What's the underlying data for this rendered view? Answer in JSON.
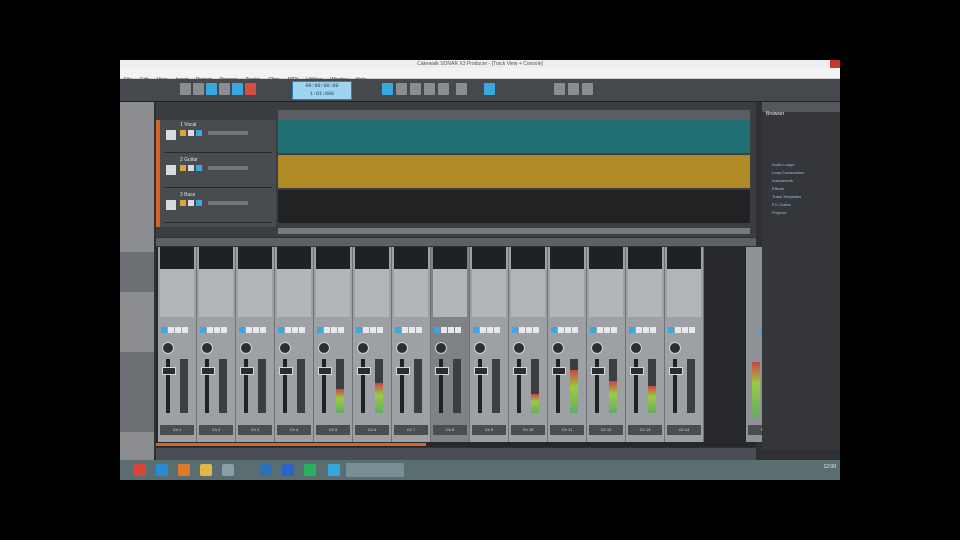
{
  "app": {
    "title": "Cakewalk SONAR X3 Producer - [Track View + Console]",
    "accent": "#3fa6d9",
    "track_color": "#d9622b"
  },
  "menu": [
    "File",
    "Edit",
    "View",
    "Insert",
    "Project",
    "Process",
    "Tracks",
    "Clips",
    "MIDI",
    "Utilities",
    "Window",
    "Help"
  ],
  "transport": {
    "time_primary": "00:00:00:00",
    "time_secondary": "1:01:000"
  },
  "tracks": [
    {
      "name": "1 Vocal",
      "clip_color": "#1f6f73"
    },
    {
      "name": "2 Guitar",
      "clip_color": "#b08a25"
    },
    {
      "name": "3 Bass",
      "clip_color": "#202224"
    }
  ],
  "console": {
    "strips": [
      {
        "name": "Ch 1",
        "meter": 0.0
      },
      {
        "name": "Ch 2",
        "meter": 0.0
      },
      {
        "name": "Ch 3",
        "meter": 0.0
      },
      {
        "name": "Ch 4",
        "meter": 0.0
      },
      {
        "name": "Ch 5",
        "meter": 0.45
      },
      {
        "name": "Ch 6",
        "meter": 0.55
      },
      {
        "name": "Ch 7",
        "meter": 0.0
      },
      {
        "name": "Ch 8",
        "meter": 0.0
      },
      {
        "name": "Ch 9",
        "meter": 0.0
      },
      {
        "name": "Ch 10",
        "meter": 0.35
      },
      {
        "name": "Ch 11",
        "meter": 0.8
      },
      {
        "name": "Ch 12",
        "meter": 0.6
      },
      {
        "name": "Ch 13",
        "meter": 0.5
      },
      {
        "name": "Ch 14",
        "meter": 0.0
      }
    ],
    "master_label": "Master"
  },
  "browser": {
    "title": "Browser",
    "items": [
      "Audio Loops",
      "Loop Construction",
      "Instruments",
      "Effects",
      "Track Templates",
      "FX Chains",
      "Projects"
    ]
  },
  "taskbar": {
    "clock": "12:00"
  }
}
